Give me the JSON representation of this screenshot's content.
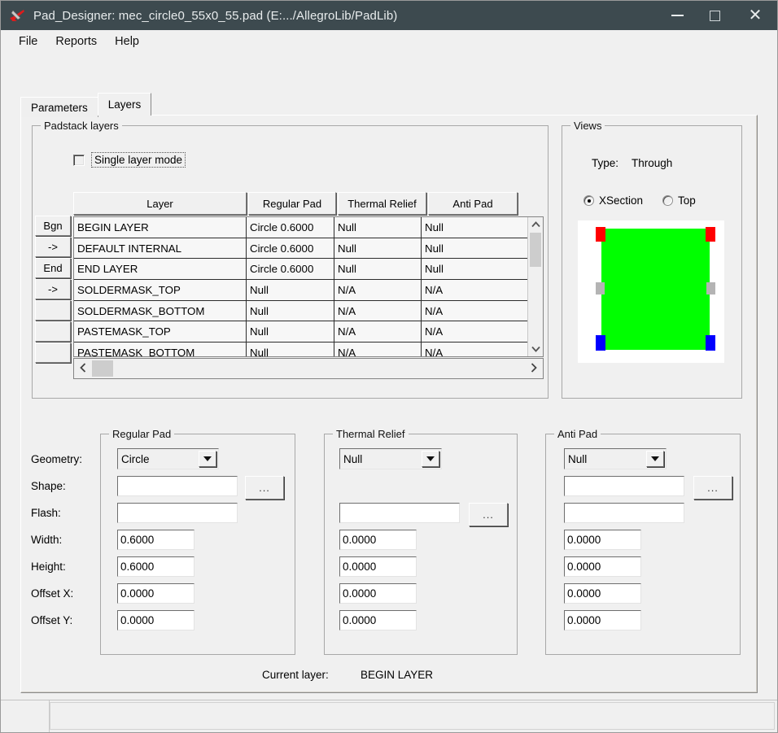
{
  "window": {
    "title": "Pad_Designer: mec_circle0_55x0_55.pad (E:.../AllegroLib/PadLib)",
    "icon": "allegro-plane-icon",
    "controls": {
      "minimize": "minimize-icon",
      "maximize": "maximize-icon",
      "close": "close-icon"
    }
  },
  "menubar": {
    "items": [
      {
        "label": "File"
      },
      {
        "label": "Reports"
      },
      {
        "label": "Help"
      }
    ]
  },
  "tabs": [
    {
      "label": "Parameters",
      "active": false
    },
    {
      "label": "Layers",
      "active": true
    }
  ],
  "padstack": {
    "group_title": "Padstack layers",
    "single_layer_mode": {
      "label": "Single layer mode",
      "checked": false
    },
    "row_buttons": [
      "Bgn",
      "->",
      "End",
      "->",
      "",
      "",
      ""
    ],
    "columns": [
      "Layer",
      "Regular Pad",
      "Thermal Relief",
      "Anti Pad"
    ],
    "rows": [
      {
        "layer": "BEGIN LAYER",
        "regular": "Circle 0.6000",
        "thermal": "Null",
        "anti": "Null"
      },
      {
        "layer": "DEFAULT INTERNAL",
        "regular": "Circle 0.6000",
        "thermal": "Null",
        "anti": "Null"
      },
      {
        "layer": "END LAYER",
        "regular": "Circle 0.6000",
        "thermal": "Null",
        "anti": "Null"
      },
      {
        "layer": "SOLDERMASK_TOP",
        "regular": "Null",
        "thermal": "N/A",
        "anti": "N/A"
      },
      {
        "layer": "SOLDERMASK_BOTTOM",
        "regular": "Null",
        "thermal": "N/A",
        "anti": "N/A"
      },
      {
        "layer": "PASTEMASK_TOP",
        "regular": "Null",
        "thermal": "N/A",
        "anti": "N/A"
      },
      {
        "layer": "PASTEMASK_BOTTOM",
        "regular": "Null",
        "thermal": "N/A",
        "anti": "N/A"
      }
    ],
    "scroll": {
      "up_icon": "chevron-up-icon",
      "down_icon": "chevron-down-icon",
      "left_icon": "chevron-left-icon",
      "right_icon": "chevron-right-icon"
    }
  },
  "views": {
    "group_title": "Views",
    "type_label": "Type:",
    "type_value": "Through",
    "radios": [
      {
        "label": "XSection",
        "selected": true
      },
      {
        "label": "Top",
        "selected": false
      }
    ],
    "preview_colors": {
      "background": "#ffffff",
      "pad": "#00ff00",
      "top_marker": "#ff0000",
      "bottom_marker": "#0000ff",
      "side_marker": "#b4b4b4"
    }
  },
  "fields": {
    "labels": {
      "geometry": "Geometry:",
      "shape": "Shape:",
      "flash": "Flash:",
      "width": "Width:",
      "height": "Height:",
      "offset_x": "Offset X:",
      "offset_y": "Offset Y:"
    }
  },
  "regular_pad": {
    "group_title": "Regular Pad",
    "geometry": "Circle",
    "shape": "",
    "flash": "",
    "width": "0.6000",
    "height": "0.6000",
    "offset_x": "0.0000",
    "offset_y": "0.0000",
    "browse_label": "..."
  },
  "thermal_relief": {
    "group_title": "Thermal Relief",
    "geometry": "Null",
    "shape": "",
    "width": "0.0000",
    "height": "0.0000",
    "offset_x": "0.0000",
    "offset_y": "0.0000",
    "browse_label": "..."
  },
  "anti_pad": {
    "group_title": "Anti Pad",
    "geometry": "Null",
    "shape": "",
    "flash": "",
    "width": "0.0000",
    "height": "0.0000",
    "offset_x": "0.0000",
    "offset_y": "0.0000",
    "browse_label": "..."
  },
  "current_layer": {
    "label": "Current layer:",
    "value": "BEGIN LAYER"
  },
  "statusbar": {
    "left": "",
    "right": ""
  }
}
